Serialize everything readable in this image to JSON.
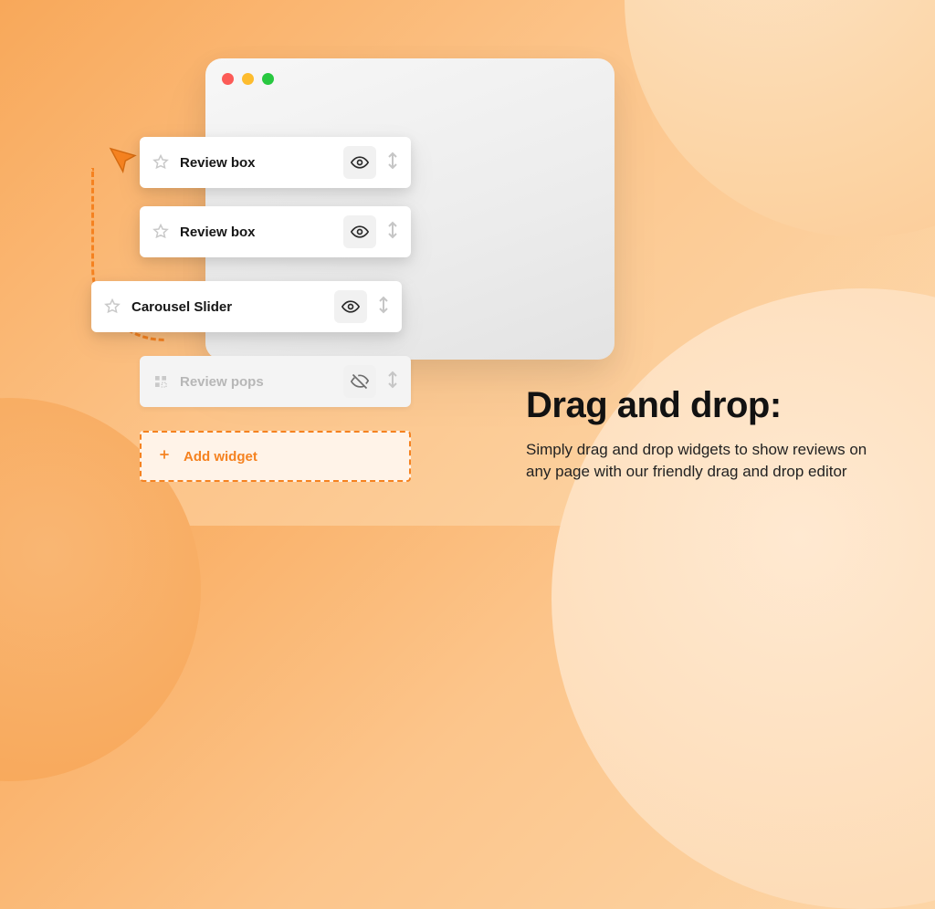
{
  "widgets": [
    {
      "label": "Review box",
      "visible": true
    },
    {
      "label": "Review box",
      "visible": true
    },
    {
      "label": "Carousel Slider",
      "visible": true
    },
    {
      "label": "Review pops",
      "visible": false
    }
  ],
  "add_widget_label": "Add widget",
  "copy": {
    "heading": "Drag and drop:",
    "body": "Simply drag and drop widgets to show reviews on any page with our friendly drag and drop editor"
  }
}
